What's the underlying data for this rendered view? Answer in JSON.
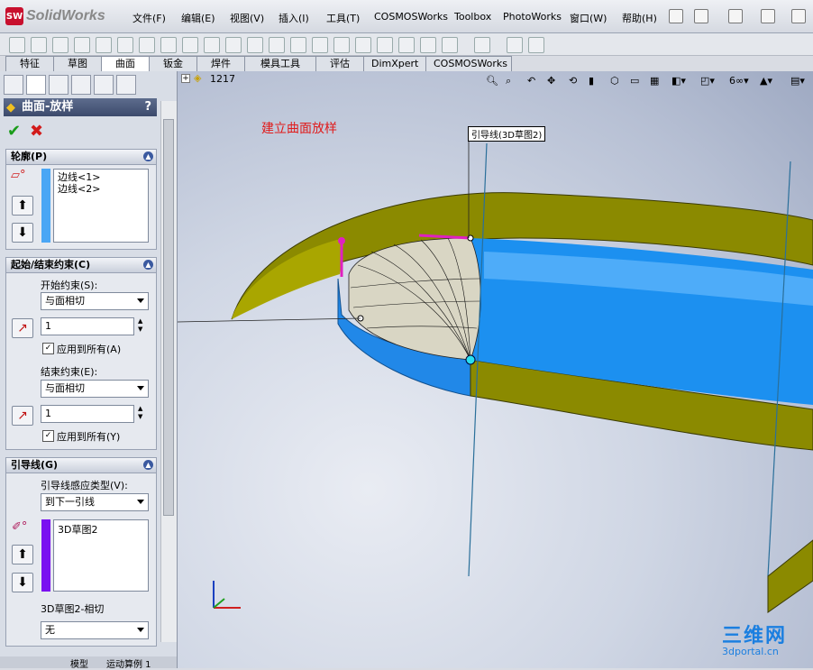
{
  "app": {
    "logo_text": "SolidWorks",
    "logo_badge": "SW"
  },
  "menu": [
    "文件(F)",
    "编辑(E)",
    "视图(V)",
    "插入(I)",
    "工具(T)",
    "COSMOSWorks",
    "Toolbox",
    "PhotoWorks",
    "窗口(W)",
    "帮助(H)"
  ],
  "tabs": [
    "特征",
    "草图",
    "曲面",
    "钣金",
    "焊件",
    "模具工具",
    "评估",
    "DimXpert",
    "COSMOSWorks"
  ],
  "active_tab": "曲面",
  "tree_header": {
    "expand": "+",
    "text": "1217"
  },
  "property_manager": {
    "title": "曲面-放样",
    "help": "?",
    "ok": "✔",
    "cancel": "✖",
    "profile": {
      "title": "轮廓(P)",
      "items": [
        "边线<1>",
        "边线<2>"
      ]
    },
    "constraints": {
      "title": "起始/结束约束(C)",
      "start_label": "开始约束(S):",
      "start_value": "与面相切",
      "start_spin": "1",
      "start_apply": "应用到所有(A)",
      "end_label": "结束约束(E):",
      "end_value": "与面相切",
      "end_spin": "1",
      "end_apply": "应用到所有(Y)"
    },
    "guides": {
      "title": "引导线(G)",
      "influence_label": "引导线感应类型(V):",
      "influence_value": "到下一引线",
      "items": [
        "3D草图2"
      ],
      "tangency_label": "3D草图2-相切",
      "tangency_value": "无"
    }
  },
  "bottom_tabs": [
    "模型",
    "运动算例 1"
  ],
  "viewport": {
    "annotation": "建立曲面放样",
    "callout": "引导线(3D草图2)",
    "watermark_big": "三维网",
    "watermark_small": "3dportal.cn"
  },
  "colors": {
    "accent_red": "#e01b1b",
    "surface_olive": "#8a8a00",
    "surface_blue": "#1e90ff",
    "guide_magenta": "#e020c0"
  }
}
